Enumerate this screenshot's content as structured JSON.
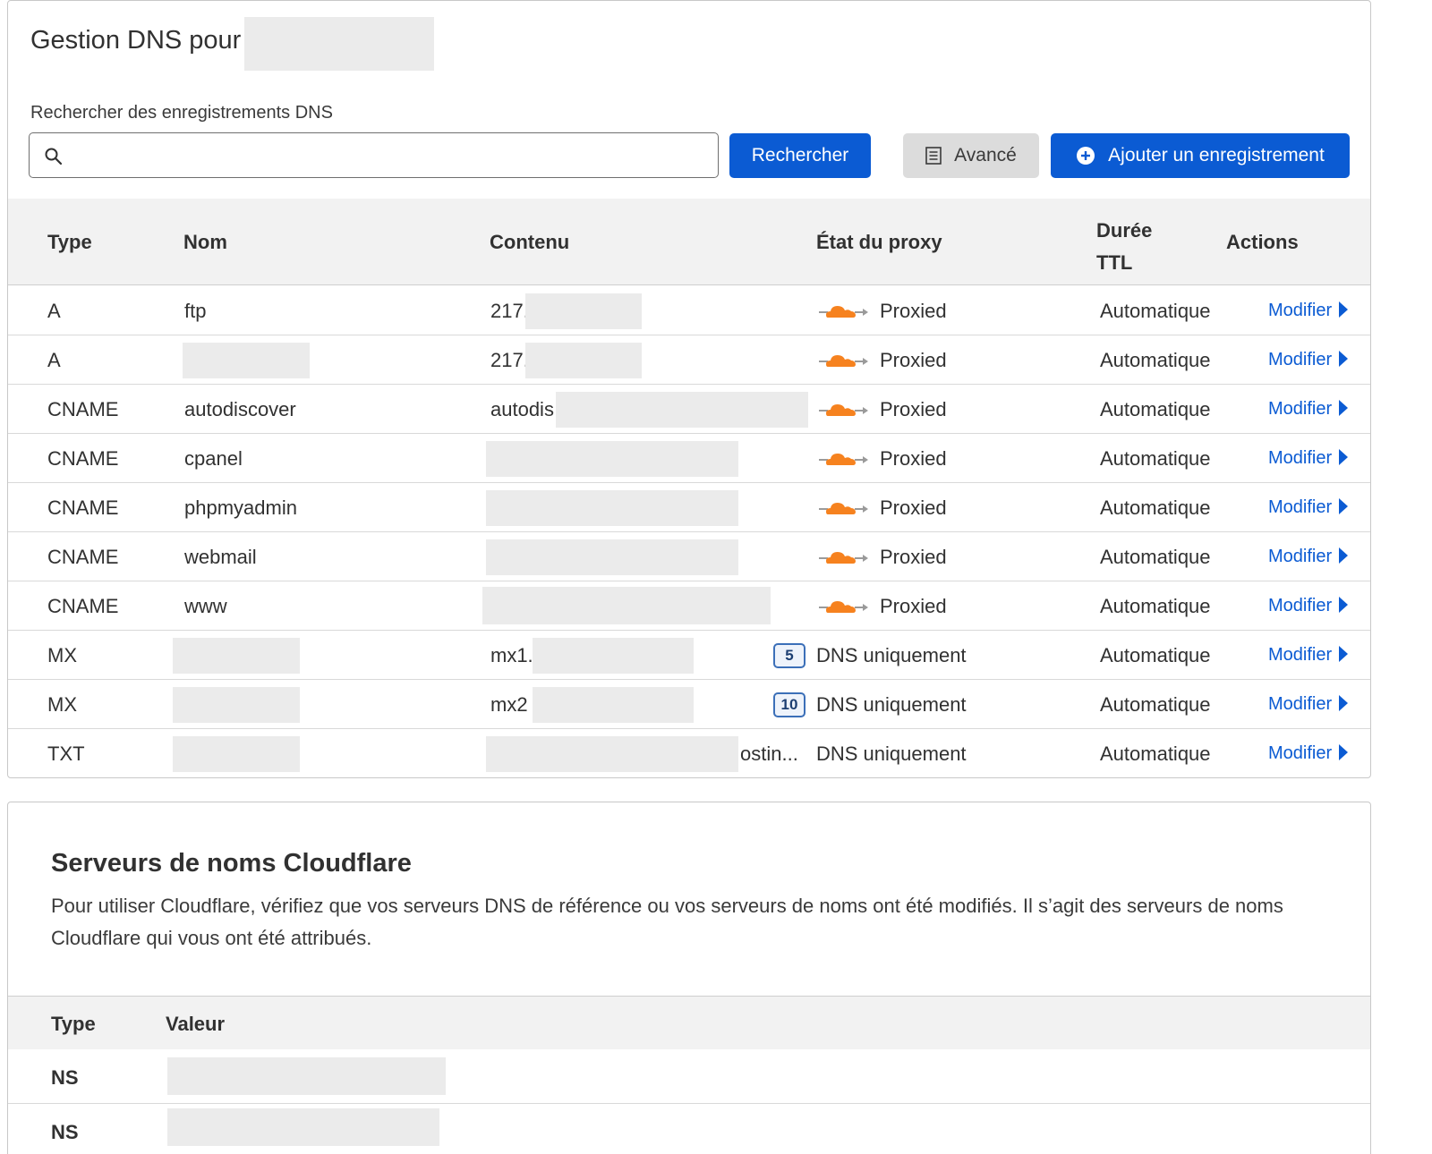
{
  "dns": {
    "title": "Gestion DNS pour",
    "search_label": "Rechercher des enregistrements DNS",
    "search_placeholder": "",
    "search_value": "",
    "btn_search": "Rechercher",
    "btn_advanced": "Avancé",
    "btn_add": "Ajouter un enregistrement",
    "columns": {
      "type": "Type",
      "name": "Nom",
      "content": "Contenu",
      "proxy": "État du proxy",
      "ttl_line1": "Durée",
      "ttl_line2": "TTL",
      "actions": "Actions"
    },
    "records": [
      {
        "type": "A",
        "name": "ftp",
        "content": "217.",
        "proxy": "Proxied",
        "ttl": "Automatique",
        "action": "Modifier"
      },
      {
        "type": "A",
        "name": "",
        "content": "217.",
        "proxy": "Proxied",
        "ttl": "Automatique",
        "action": "Modifier"
      },
      {
        "type": "CNAME",
        "name": "autodiscover",
        "content": "autodis",
        "proxy": "Proxied",
        "ttl": "Automatique",
        "action": "Modifier"
      },
      {
        "type": "CNAME",
        "name": "cpanel",
        "content": "",
        "proxy": "Proxied",
        "ttl": "Automatique",
        "action": "Modifier"
      },
      {
        "type": "CNAME",
        "name": "phpmyadmin",
        "content": "",
        "proxy": "Proxied",
        "ttl": "Automatique",
        "action": "Modifier"
      },
      {
        "type": "CNAME",
        "name": "webmail",
        "content": "",
        "proxy": "Proxied",
        "ttl": "Automatique",
        "action": "Modifier"
      },
      {
        "type": "CNAME",
        "name": "www",
        "content": "",
        "proxy": "Proxied",
        "ttl": "Automatique",
        "action": "Modifier"
      },
      {
        "type": "MX",
        "name": "",
        "content": "mx1.",
        "priority": "5",
        "proxy": "DNS uniquement",
        "ttl": "Automatique",
        "action": "Modifier"
      },
      {
        "type": "MX",
        "name": "",
        "content": "mx2",
        "priority": "10",
        "proxy": "DNS uniquement",
        "ttl": "Automatique",
        "action": "Modifier"
      },
      {
        "type": "TXT",
        "name": "",
        "content": "ostin...",
        "proxy": "DNS uniquement",
        "ttl": "Automatique",
        "action": "Modifier"
      }
    ],
    "colors": {
      "accent": "#0b5bd3",
      "cloud": "#f6821f",
      "header_bg": "#f2f2f2",
      "mask": "#ebebeb"
    }
  },
  "ns": {
    "title": "Serveurs de noms Cloudflare",
    "description": "Pour utiliser Cloudflare, vérifiez que vos serveurs DNS de référence ou vos serveurs de noms ont été modifiés. Il s’agit des serveurs de noms Cloudflare qui vous ont été attribués.",
    "columns": {
      "type": "Type",
      "value": "Valeur"
    },
    "rows": [
      {
        "type": "NS",
        "value": ""
      },
      {
        "type": "NS",
        "value": ""
      }
    ]
  },
  "icons": [
    "search-icon",
    "list-icon",
    "plus-circle-icon",
    "cloud-icon",
    "caret-right-icon"
  ]
}
